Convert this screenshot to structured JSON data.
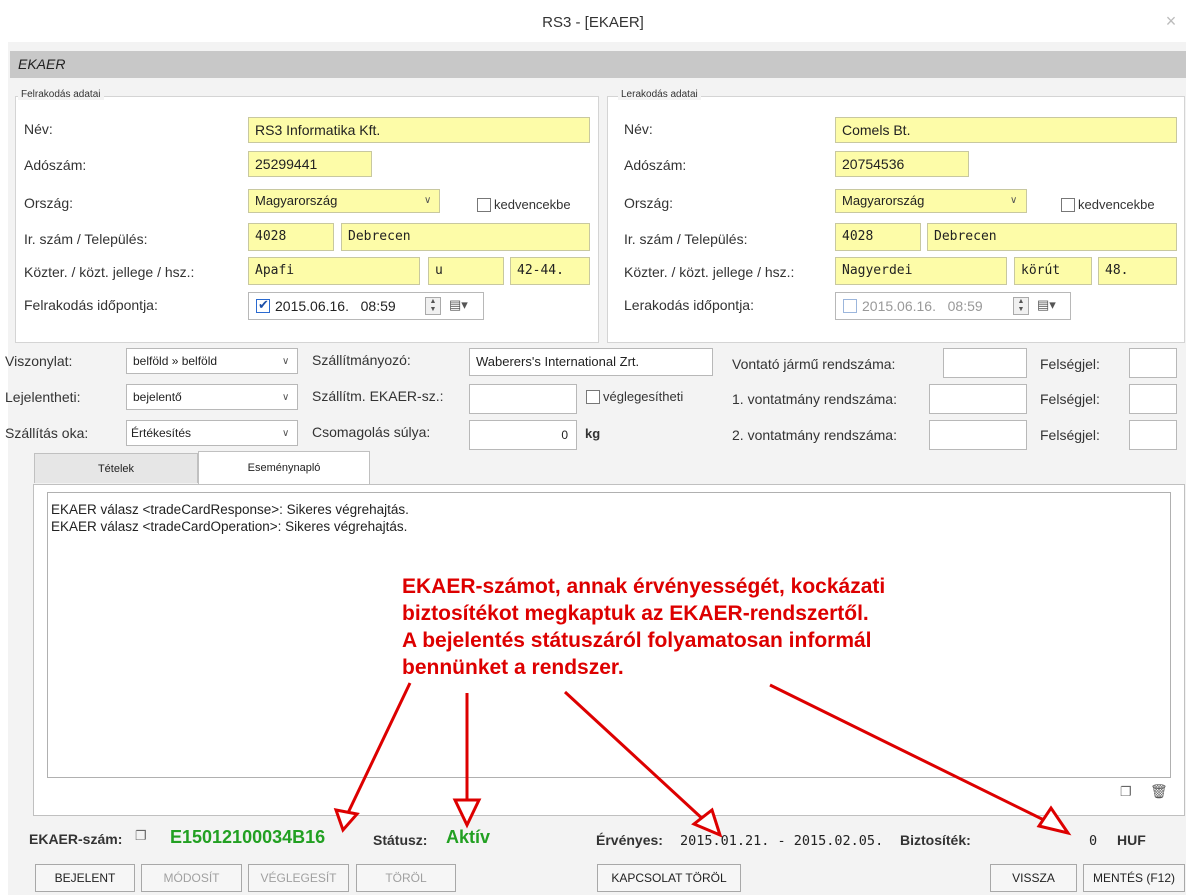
{
  "window": {
    "title": "RS3 - [EKAER]",
    "close": "×"
  },
  "section": {
    "title": "EKAER"
  },
  "loading": {
    "legend": "Felrakodás adatai",
    "labels": {
      "name": "Név:",
      "tax": "Adószám:",
      "country": "Ország:",
      "zip_city": "Ir. szám / Település:",
      "street": "Közter. / közt. jellege / hsz.:",
      "time": "Felrakodás időpontja:"
    },
    "name": "RS3 Informatika Kft.",
    "tax": "25299441",
    "country": "Magyarország",
    "favorite_label": "kedvencekbe",
    "zip": "4028",
    "city": "Debrecen",
    "street": "Apafi",
    "street_type": "u",
    "house_no": "42-44.",
    "date": "2015.06.16.",
    "time": "08:59",
    "time_checked": true
  },
  "unloading": {
    "legend": "Lerakodás adatai",
    "labels": {
      "name": "Név:",
      "tax": "Adószám:",
      "country": "Ország:",
      "zip_city": "Ir. szám / Település:",
      "street": "Közter. / közt. jellege / hsz.:",
      "time": "Lerakodás időpontja:"
    },
    "name": "Comels Bt.",
    "tax": "20754536",
    "country": "Magyarország",
    "favorite_label": "kedvencekbe",
    "zip": "4028",
    "city": "Debrecen",
    "street": "Nagyerdei",
    "street_type": "körút",
    "house_no": "48.",
    "date": "2015.06.16.",
    "time": "08:59",
    "time_checked": false
  },
  "transport": {
    "relation_label": "Viszonylat:",
    "relation_value": "belföld » belföld",
    "reportable_label": "Lejelentheti:",
    "reportable_value": "bejelentő",
    "reason_label": "Szállítás oka:",
    "reason_value": "Értékesítés",
    "carrier_label": "Szállítmányozó:",
    "carrier_value": "Waberers's International Zrt.",
    "carrier_ekaer_label": "Szállítm. EKAER-sz.:",
    "finalize_label": "véglegesítheti",
    "package_weight_label": "Csomagolás súlya:",
    "package_weight_value": "0",
    "package_weight_unit": "kg",
    "tractor_label": "Vontató jármű rendszáma:",
    "trailer1_label": "1. vontatmány rendszáma:",
    "trailer2_label": "2. vontatmány rendszáma:",
    "nationality_label": "Felségjel:"
  },
  "tabs": [
    {
      "label": "Tételek"
    },
    {
      "label": "Eseménynapló"
    }
  ],
  "log": [
    "EKAER válasz <tradeCardResponse>: Sikeres végrehajtás.",
    "EKAER válasz <tradeCardOperation>: Sikeres végrehajtás."
  ],
  "annotation": [
    "EKAER-számot, annak érvényességét, kockázati",
    "biztosítékot megkaptuk az EKAER-rendszertől.",
    "A bejelentés státuszáról folyamatosan informál",
    "bennünket a rendszer."
  ],
  "status_bar": {
    "ekaer_label": "EKAER-szám:",
    "ekaer_number": "E15012100034B16",
    "status_label": "Státusz:",
    "status_value": "Aktív",
    "valid_label": "Érvényes:",
    "valid_value": "2015.01.21. - 2015.02.05.",
    "guarantee_label": "Biztosíték:",
    "guarantee_value": "0",
    "currency": "HUF"
  },
  "buttons": {
    "report": "BEJELENT",
    "modify": "MÓDOSÍT",
    "finalize": "VÉGLEGESÍT",
    "delete": "TÖRÖL",
    "unlink": "KAPCSOLAT TÖRÖL",
    "back": "VISSZA",
    "save": "MENTÉS (F12)"
  },
  "colors": {
    "field": "#fdfca8",
    "status_green": "#22a022",
    "annotation_red": "#dd0000"
  }
}
